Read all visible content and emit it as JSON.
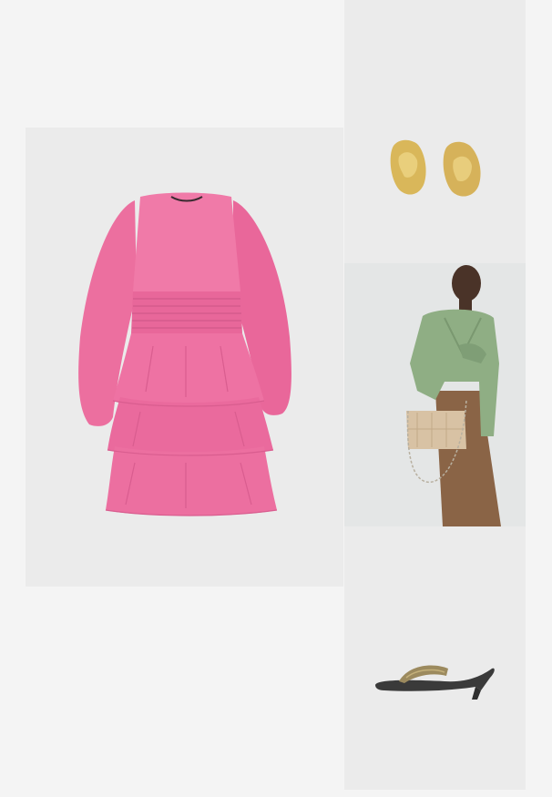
{
  "items": [
    {
      "name": "dress",
      "icon": "pink-tiered-dress",
      "color": "#ee6a9e"
    },
    {
      "name": "earrings",
      "icon": "gold-earrings",
      "color": "#d9b75a"
    },
    {
      "name": "model",
      "icon": "model-green-jacket-beige-bag",
      "color": "#8fae84"
    },
    {
      "name": "sandals",
      "icon": "kitten-heel-thong-sandal",
      "color": "#9c8a5e"
    }
  ]
}
